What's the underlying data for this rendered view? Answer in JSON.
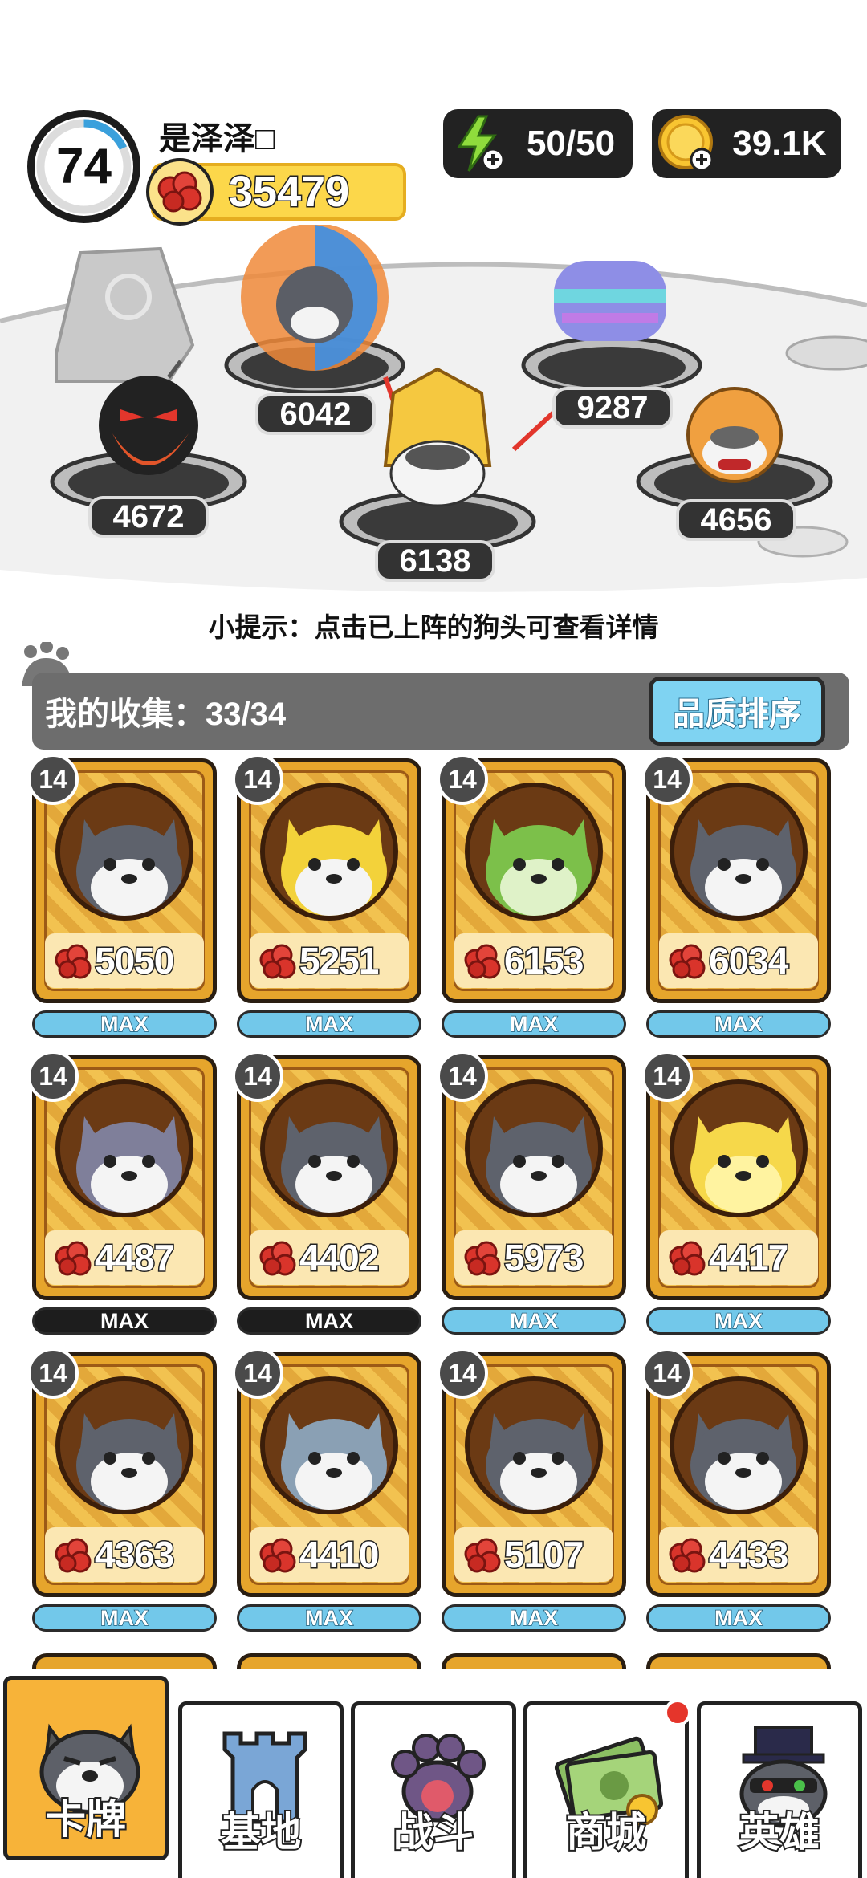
{
  "header": {
    "level": "74",
    "level_progress": 0.18,
    "player_name": "是泽泽□",
    "power": "35479",
    "energy": "50/50",
    "coins": "39.1K"
  },
  "arena": {
    "lineup_scores": [
      "6042",
      "9287",
      "4672",
      "6138",
      "4656"
    ]
  },
  "tip_text": "小提示：点击已上阵的狗头可查看详情",
  "collection": {
    "label": "我的收集：33/34",
    "sort_button": "品质排序"
  },
  "cards": [
    {
      "level": "14",
      "power": "5050",
      "max": "MAX",
      "max_style": "blue"
    },
    {
      "level": "14",
      "power": "5251",
      "max": "MAX",
      "max_style": "blue"
    },
    {
      "level": "14",
      "power": "6153",
      "max": "MAX",
      "max_style": "blue"
    },
    {
      "level": "14",
      "power": "6034",
      "max": "MAX",
      "max_style": "blue"
    },
    {
      "level": "14",
      "power": "4487",
      "max": "MAX",
      "max_style": "dark"
    },
    {
      "level": "14",
      "power": "4402",
      "max": "MAX",
      "max_style": "dark"
    },
    {
      "level": "14",
      "power": "5973",
      "max": "MAX",
      "max_style": "blue"
    },
    {
      "level": "14",
      "power": "4417",
      "max": "MAX",
      "max_style": "blue"
    },
    {
      "level": "14",
      "power": "4363",
      "max": "MAX",
      "max_style": "blue"
    },
    {
      "level": "14",
      "power": "4410",
      "max": "MAX",
      "max_style": "blue"
    },
    {
      "level": "14",
      "power": "5107",
      "max": "MAX",
      "max_style": "blue"
    },
    {
      "level": "14",
      "power": "4433",
      "max": "MAX",
      "max_style": "blue"
    }
  ],
  "nav": {
    "tabs": [
      {
        "label": "卡牌",
        "icon": "dog-face-icon",
        "active": true
      },
      {
        "label": "基地",
        "icon": "castle-icon",
        "active": false
      },
      {
        "label": "战斗",
        "icon": "paw-icon",
        "active": false
      },
      {
        "label": "商城",
        "icon": "money-icon",
        "active": false,
        "badge": true
      },
      {
        "label": "英雄",
        "icon": "hero-dog-icon",
        "active": false
      }
    ]
  },
  "colors": {
    "card_gold": "#e6a52c",
    "max_blue": "#72c8ea",
    "power_red": "#d9342b",
    "nav_active": "#f7b339"
  }
}
